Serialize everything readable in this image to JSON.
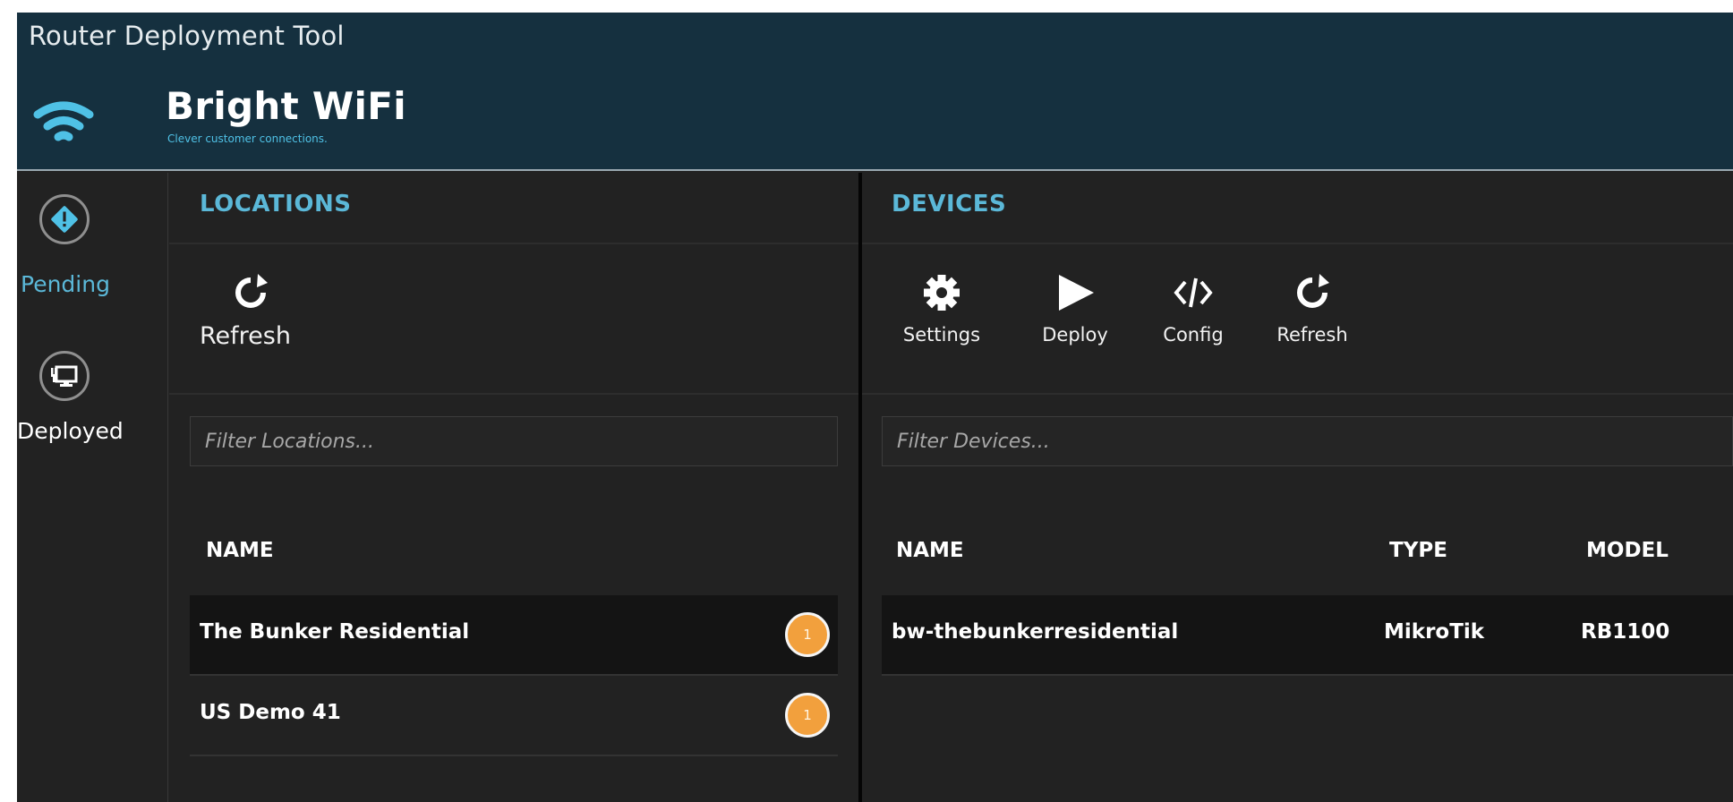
{
  "window": {
    "title": "Router Deployment Tool"
  },
  "brand": {
    "name": "Bright WiFi",
    "tagline": "Clever customer connections."
  },
  "nav": [
    {
      "label": "Pending",
      "icon": "warning-diamond-icon",
      "active": true
    },
    {
      "label": "Deployed",
      "icon": "deployed-monitor-icon",
      "active": false
    }
  ],
  "locations": {
    "title": "LOCATIONS",
    "refresh_label": "Refresh",
    "filter_placeholder": "Filter Locations...",
    "columns": {
      "name": "NAME"
    },
    "rows": [
      {
        "name": "The Bunker Residential",
        "count": "1",
        "selected": true
      },
      {
        "name": "US Demo 41",
        "count": "1",
        "selected": false
      }
    ]
  },
  "devices": {
    "title": "DEVICES",
    "toolbar": {
      "settings_label": "Settings",
      "deploy_label": "Deploy",
      "config_label": "Config",
      "refresh_label": "Refresh"
    },
    "filter_placeholder": "Filter Devices...",
    "columns": {
      "name": "NAME",
      "type": "TYPE",
      "model": "MODEL"
    },
    "rows": [
      {
        "name": "bw-thebunkerresidential",
        "type": "MikroTik",
        "model": "RB1100"
      }
    ]
  },
  "colors": {
    "header_bg": "#15303f",
    "panel_bg": "#222222",
    "accent": "#5bb8d8",
    "badge": "#f2a03d"
  }
}
